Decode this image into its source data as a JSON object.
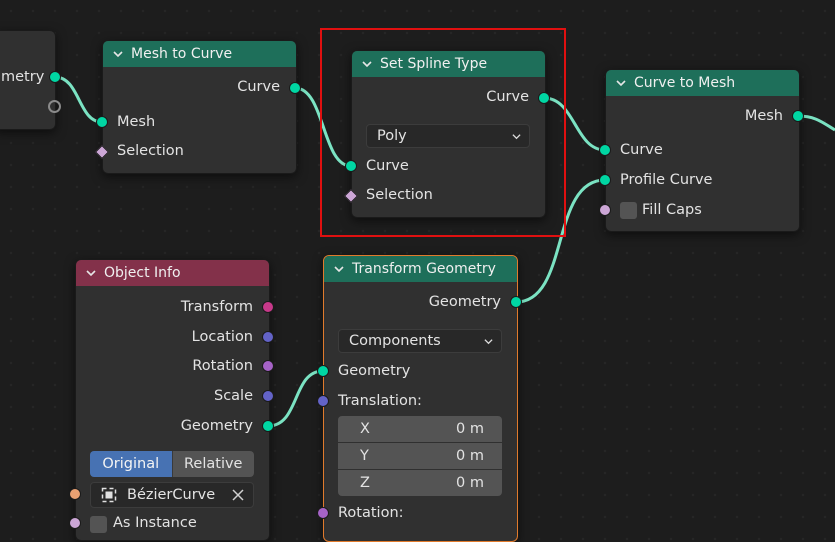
{
  "colors": {
    "link": "#7be3c3",
    "geometry_socket": "#00d6a3",
    "geometry_header": "#1e6f5a",
    "input_header": "#83314a",
    "selection_outline": "#e01010",
    "active_node_outline": "#e07a2c",
    "segment_active": "#4772b3"
  },
  "nodes": {
    "partial_left": {
      "output_label": "metry"
    },
    "mesh_to_curve": {
      "title": "Mesh to Curve",
      "output_curve": "Curve",
      "input_mesh": "Mesh",
      "input_selection": "Selection"
    },
    "set_spline_type": {
      "title": "Set Spline Type",
      "output_curve": "Curve",
      "type_dropdown": "Poly",
      "input_curve": "Curve",
      "input_selection": "Selection"
    },
    "curve_to_mesh": {
      "title": "Curve to Mesh",
      "output_mesh": "Mesh",
      "input_curve": "Curve",
      "input_profile_curve": "Profile Curve",
      "input_fill_caps": "Fill Caps"
    },
    "object_info": {
      "title": "Object Info",
      "outputs": [
        "Transform",
        "Location",
        "Rotation",
        "Scale",
        "Geometry"
      ],
      "mode_original": "Original",
      "mode_relative": "Relative",
      "object_name": "BézierCurve",
      "as_instance": "As Instance"
    },
    "transform_geometry": {
      "title": "Transform Geometry",
      "output_geometry": "Geometry",
      "mode_dropdown": "Components",
      "input_geometry": "Geometry",
      "input_translation": "Translation:",
      "translation": [
        {
          "axis": "X",
          "value": "0 m"
        },
        {
          "axis": "Y",
          "value": "0 m"
        },
        {
          "axis": "Z",
          "value": "0 m"
        }
      ],
      "input_rotation": "Rotation:"
    }
  }
}
